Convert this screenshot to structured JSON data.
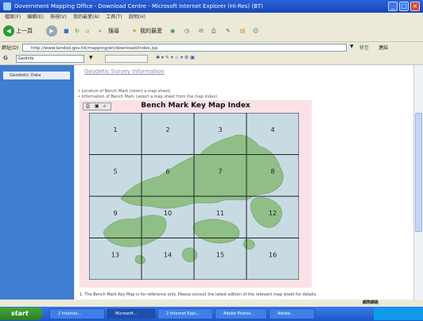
{
  "window": {
    "title": "Government Mapping Office - Download Centre - Microsoft Internet Explorer (Hi-Res) (BT)",
    "minimize": "_",
    "maximize": "□",
    "close": "×"
  },
  "menu": [
    "檔案(F)",
    "編輯(E)",
    "檢視(V)",
    "我的最愛(A)",
    "工具(T)",
    "說明(H)"
  ],
  "toolbar": {
    "back_label": "上一頁",
    "search_label": "搜尋",
    "favorites_label": "我的最愛"
  },
  "address": {
    "label": "網址(D)",
    "url": "http://www.landsd.gov.hk/mapping/en/download/index.jsp",
    "go_label": "移至",
    "links_label": "連結"
  },
  "googlebar": {
    "search_value": "GeoInfo"
  },
  "sidebar": {
    "item_label": "Geodetic Data"
  },
  "content": {
    "page_title": "Geodetic Survey Information",
    "bullets": [
      "Location of Bench Mark (select a map sheet)",
      "Information of Bench Mark (select a map sheet from the map index)"
    ],
    "map_title": "Bench Mark Key Map Index",
    "caption": "1. The Bench Mark Key Map is for reference only. Please consult the latest edition of the relevant map sheet for details."
  },
  "map": {
    "land_color": "#8fbf86",
    "sea_color": "#c8dbe3",
    "grid_color": "#222222",
    "sheet_numbers": [
      "1",
      "2",
      "3",
      "4",
      "5",
      "6",
      "7",
      "8",
      "9",
      "10",
      "11",
      "12",
      "13",
      "14",
      "15",
      "16"
    ]
  },
  "status": {
    "zone_label": "網際網路"
  },
  "taskbar": {
    "start_label": "start",
    "tasks": [
      "2 Internet...",
      "Microsoft...",
      "2 Internet Expl...",
      "Adobe Photos...",
      "Adobe..."
    ]
  }
}
